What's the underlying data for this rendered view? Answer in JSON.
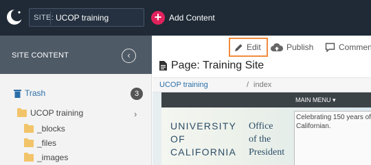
{
  "topbar": {
    "site_label": "SITE:",
    "site_value": "UCOP training",
    "add_content": "Add Content"
  },
  "sidebar": {
    "title": "SITE CONTENT",
    "trash": {
      "label": "Trash",
      "count": "3"
    },
    "tree": {
      "root": "UCOP training",
      "children": [
        "_blocks",
        "_files",
        "_images"
      ]
    }
  },
  "toolbar": {
    "edit": "Edit",
    "publish": "Publish",
    "comments": "Commen"
  },
  "page": {
    "title": "Page: Training Site"
  },
  "breadcrumb": {
    "site": "UCOP training",
    "separator": "/",
    "current": "index"
  },
  "preview": {
    "menu": "MAIN MENU ▾",
    "uc_line1": "UNIVERSITY",
    "uc_line2": "OF",
    "uc_line3": "CALIFORNIA",
    "office_line1": "Office",
    "office_line2": "of the",
    "office_line3": "President",
    "image_alt": "Celebrating 150 years of Californian."
  },
  "colors": {
    "topbar": "#1f2a36",
    "accent_pink": "#e0225c",
    "edit_highlight": "#f08a3c",
    "link": "#2a6ea8"
  }
}
